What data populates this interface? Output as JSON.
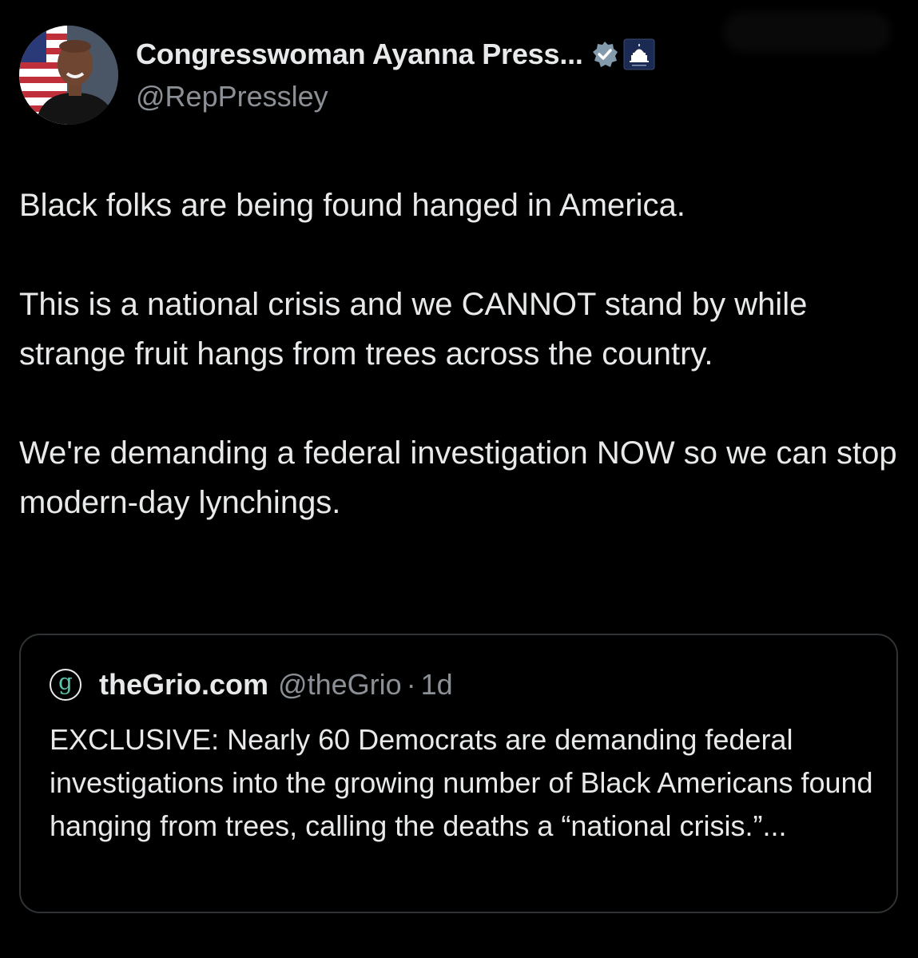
{
  "author": {
    "display_name": "Congresswoman Ayanna Press...",
    "handle": "@RepPressley",
    "avatar_icon": "profile-photo-avatar",
    "verified_icon": "verified-badge-icon",
    "affiliation_icon": "capitol-building-icon"
  },
  "tweet": {
    "paragraph_1": "Black folks are being found hanged in America.",
    "paragraph_2": "This is a national crisis and we CANNOT stand by while strange fruit hangs from trees across the country.",
    "paragraph_3": "We're demanding a federal investigation NOW so we can stop modern-day lynchings."
  },
  "quoted_tweet": {
    "logo_letter": "g",
    "display_name": "theGrio.com",
    "handle": "@theGrio",
    "separator": "·",
    "time": "1d",
    "text": "EXCLUSIVE: Nearly 60 Democrats are demanding federal investigations into the growing number of Black Americans found hanging from trees, calling the deaths a “national crisis.”..."
  },
  "colors": {
    "background": "#000000",
    "primary_text": "#e7e9ea",
    "secondary_text": "#8b9096",
    "border": "#2f3336",
    "verified_badge": "#829aab",
    "grio_accent": "#58c4a9"
  }
}
